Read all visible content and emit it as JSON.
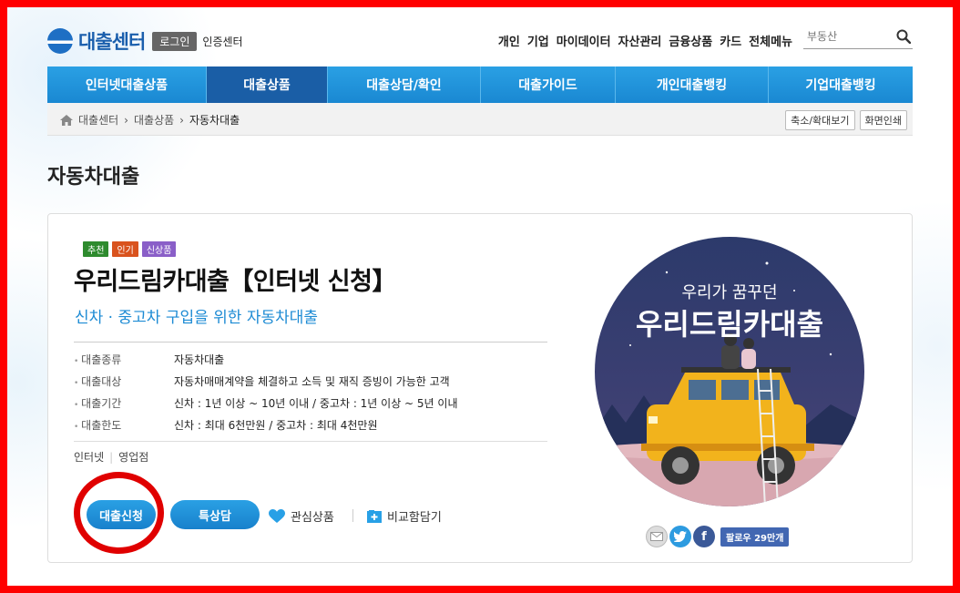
{
  "header": {
    "logo_text": "대출센터",
    "login_label": "로그인",
    "cert_label": "인증센터",
    "topnav": [
      "개인",
      "기업",
      "마이데이터",
      "자산관리",
      "금융상품",
      "카드",
      "전체메뉴"
    ],
    "search_placeholder": "부동산"
  },
  "gnb": [
    "인터넷대출상품",
    "대출상품",
    "대출상담/확인",
    "대출가이드",
    "개인대출뱅킹",
    "기업대출뱅킹"
  ],
  "breadcrumb": {
    "items": [
      "대출센터",
      "대출상품",
      "자동차대출"
    ],
    "buttons": [
      "축소/확대보기",
      "화면인쇄"
    ]
  },
  "page_title": "자동차대출",
  "product": {
    "badges": [
      "추천",
      "인기",
      "신상품"
    ],
    "name": "우리드림카대출【인터넷 신청】",
    "subtitle": "신차 · 중고차 구입을 위한 자동차대출",
    "specs": [
      {
        "k": "대출종류",
        "v": "자동차대출"
      },
      {
        "k": "대출대상",
        "v": "자동차매매계약을 체결하고 소득 및 재직 증빙이 가능한 고객"
      },
      {
        "k": "대출기간",
        "v": "신차 : 1년 이상 ~ 10년 이내 / 중고차 : 1년 이상 ~ 5년 이내"
      },
      {
        "k": "대출한도",
        "v": "신차 : 최대 6천만원 / 중고차 : 최대 4천만원"
      }
    ],
    "channels": [
      "인터넷",
      "영업점"
    ],
    "apply_label": "대출신청",
    "consult_label": "특상담",
    "favorite_label": "관심상품",
    "compare_label": "비교함담기",
    "promo_line1": "우리가 꿈꾸던",
    "promo_line2": "우리드림카대출",
    "follow_label": "팔로우 29만개"
  },
  "colors": {
    "brand_blue": "#1b5fad",
    "nav_blue": "#1a88d2",
    "accent_red": "#ff0000"
  }
}
